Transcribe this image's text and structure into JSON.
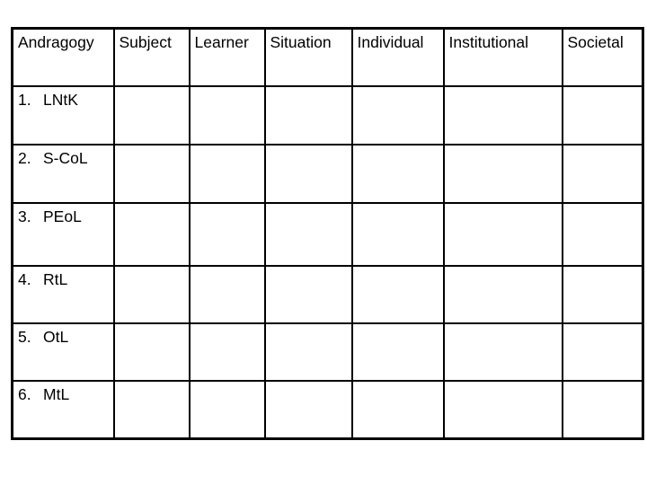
{
  "table": {
    "headers": [
      "Andragogy",
      "Subject",
      "Learner",
      "Situation",
      "Individual",
      "Institutional",
      "Societal"
    ],
    "rows": [
      {
        "num": "1.",
        "label": "LNtK",
        "cells": [
          "",
          "",
          "",
          "",
          "",
          ""
        ]
      },
      {
        "num": "2.",
        "label": "S-CoL",
        "cells": [
          "",
          "",
          "",
          "",
          "",
          ""
        ]
      },
      {
        "num": "3.",
        "label": "PEoL",
        "cells": [
          "",
          "",
          "",
          "",
          "",
          ""
        ]
      },
      {
        "num": "4.",
        "label": "RtL",
        "cells": [
          "",
          "",
          "",
          "",
          "",
          ""
        ]
      },
      {
        "num": "5.",
        "label": "OtL",
        "cells": [
          "",
          "",
          "",
          "",
          "",
          ""
        ]
      },
      {
        "num": "6.",
        "label": "MtL",
        "cells": [
          "",
          "",
          "",
          "",
          "",
          ""
        ]
      }
    ]
  }
}
